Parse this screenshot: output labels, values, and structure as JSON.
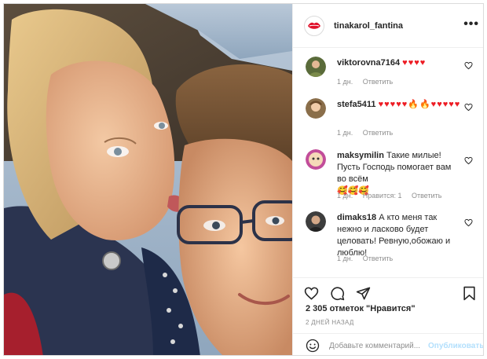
{
  "post": {
    "username": "tinakarol_fantina",
    "more_label": "•••"
  },
  "comments": [
    {
      "username": "viktorovna7164",
      "text": "",
      "emoji": "♥♥♥♥",
      "time": "1 дн.",
      "likes": "",
      "reply": "Ответить",
      "avatar_color": "#5a6b3a"
    },
    {
      "username": "stefa5411",
      "text": "",
      "emoji": "♥♥♥♥♥🔥🔥♥♥♥♥♥",
      "time": "1 дн.",
      "likes": "",
      "reply": "Ответить",
      "avatar_color": "#8a6e4a"
    },
    {
      "username": "maksymilin",
      "text": "Такие милые! Пусть Господь помогает вам во всём",
      "emoji": "🥰🥰🥰",
      "time": "1 дн.",
      "likes": "Нравится: 1",
      "reply": "Ответить",
      "avatar_color": "#c24d9a"
    },
    {
      "username": "dimaks18",
      "text": "А кто меня так нежно и ласково будет целовать! Ревную,обожаю и люблю!",
      "emoji": "",
      "time": "1 дн.",
      "likes": "",
      "reply": "Ответить",
      "avatar_color": "#3d3d3d"
    }
  ],
  "likes_summary": "2 305 отметок \"Нравится\"",
  "date": "2 ДНЕЙ НАЗАД",
  "add_comment": {
    "placeholder": "Добавьте комментарий...",
    "publish_label": "Опубликовать"
  },
  "colors": {
    "heart_red": "#ed1c24",
    "meta_gray": "#8e8e8e",
    "publish_disabled": "#b2dffc"
  }
}
